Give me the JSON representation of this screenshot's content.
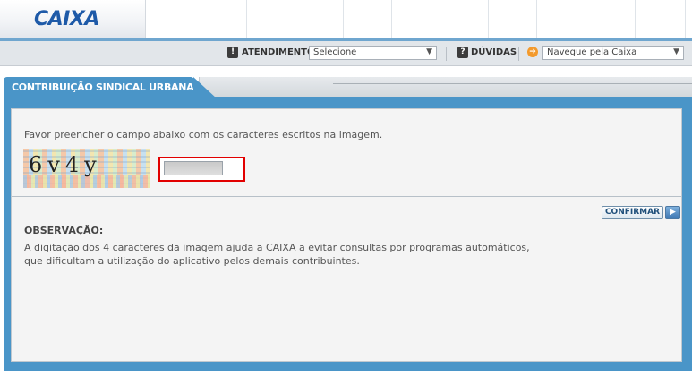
{
  "header": {
    "logo_text": "CAIXA"
  },
  "navbar": {
    "atendimento_label": "ATENDIMENTO",
    "atendimento_select": "Selecione",
    "duvidas_label": "DÚVIDAS",
    "navegue_select": "Navegue pela Caixa",
    "info_glyph": "!",
    "help_glyph": "?",
    "arrow_glyph": "➔",
    "dropdown_glyph": "▼"
  },
  "tab": {
    "label": "CONTRIBUIÇÃO SINDICAL URBANA"
  },
  "form": {
    "instruction": "Favor preencher o campo abaixo com os caracteres escritos na imagem.",
    "captcha_text": "6v4y",
    "captcha_input_value": "",
    "confirm_label": "CONFIRMAR",
    "confirm_arrow": "▶"
  },
  "observation": {
    "title": "OBSERVAÇÃO:",
    "line1": "A digitação dos 4 caracteres da imagem ajuda a CAIXA a evitar consultas por programas automáticos,",
    "line2": "que dificultam a utilização do aplicativo pelos demais contribuintes."
  },
  "colors": {
    "brand_blue": "#1e5aa8",
    "frame_blue": "#4a95c8",
    "captcha_border_red": "#e20000"
  }
}
